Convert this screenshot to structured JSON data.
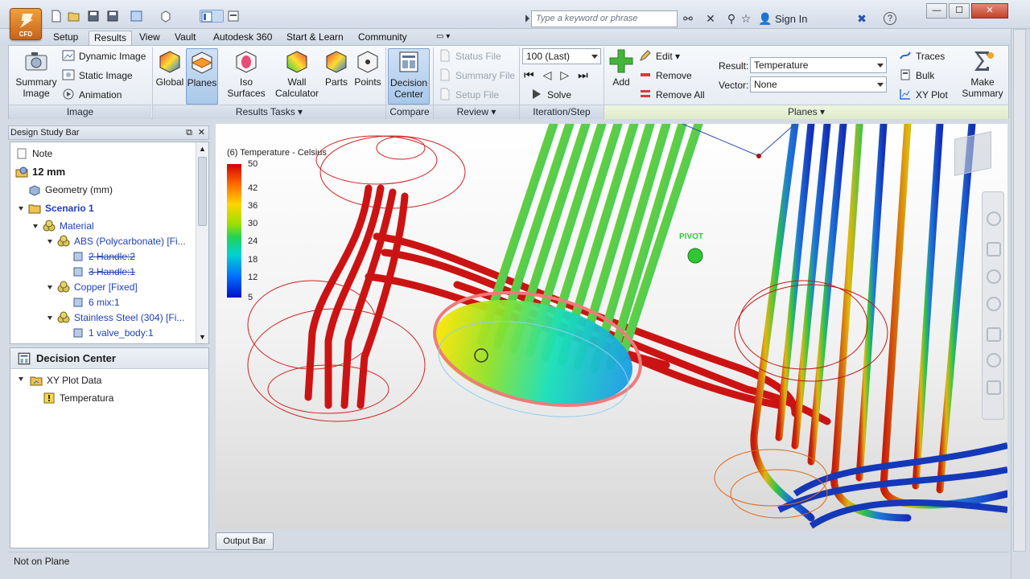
{
  "titlebar": {
    "search_placeholder": "Type a keyword or phrase",
    "sign_in": "Sign In"
  },
  "tabs": [
    {
      "label": "Setup"
    },
    {
      "label": "Results"
    },
    {
      "label": "View"
    },
    {
      "label": "Vault"
    },
    {
      "label": "Autodesk 360"
    },
    {
      "label": "Start & Learn"
    },
    {
      "label": "Community"
    }
  ],
  "ribbon": {
    "image": {
      "summary_image": "Summary Image",
      "dynamic_image": "Dynamic Image",
      "static_image": "Static Image",
      "animation": "Animation",
      "title": "Image"
    },
    "results_tasks": {
      "global": "Global",
      "planes": "Planes",
      "iso_surfaces": "Iso Surfaces",
      "wall_calculator": "Wall Calculator",
      "parts": "Parts",
      "points": "Points",
      "title": "Results Tasks"
    },
    "compare": {
      "decision_center": "Decision Center",
      "title": "Compare"
    },
    "review": {
      "status_file": "Status File",
      "summary_file": "Summary File",
      "setup_file": "Setup File",
      "title": "Review"
    },
    "iteration": {
      "select_value": "100 (Last)",
      "solve": "Solve",
      "title": "Iteration/Step"
    },
    "planes": {
      "add": "Add",
      "edit": "Edit",
      "remove": "Remove",
      "remove_all": "Remove All",
      "result_label": "Result:",
      "result_value": "Temperature",
      "vector_label": "Vector:",
      "vector_value": "None",
      "traces": "Traces",
      "bulk": "Bulk",
      "xy_plot": "XY Plot",
      "make_summary": "Make Summary",
      "title": "Planes"
    }
  },
  "design_study_bar": {
    "title": "Design Study Bar",
    "items": [
      {
        "label": "Note"
      },
      {
        "label": "12 mm"
      },
      {
        "label": "Geometry (mm)"
      },
      {
        "label": "Scenario 1"
      },
      {
        "label": "Material"
      },
      {
        "label": "ABS (Polycarbonate) [Fi..."
      },
      {
        "label": "2 Handle:2"
      },
      {
        "label": "3 Handle:1"
      },
      {
        "label": "Copper [Fixed]"
      },
      {
        "label": "6 mix:1"
      },
      {
        "label": "Stainless Steel (304) [Fi..."
      },
      {
        "label": "1 valve_body:1"
      }
    ]
  },
  "decision_center": {
    "title": "Decision Center",
    "items": [
      {
        "label": "XY Plot Data"
      },
      {
        "label": "Temperatura"
      }
    ]
  },
  "viewport": {
    "legend_title": "(6) Temperature - Celsius",
    "legend_ticks": [
      "50",
      "42",
      "36",
      "30",
      "24",
      "18",
      "12",
      "5"
    ],
    "pivot_label": "PIVOT"
  },
  "output_bar": "Output Bar",
  "status_text": "Not on Plane",
  "colors": {
    "accent": "#a9c8ea",
    "tree_link": "#1f3fb8"
  }
}
